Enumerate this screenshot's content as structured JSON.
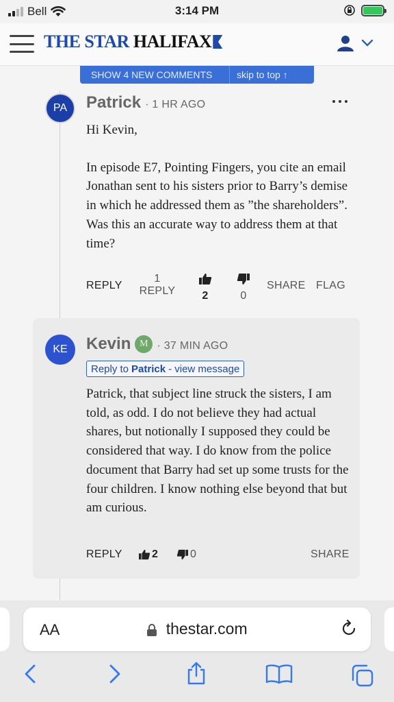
{
  "status_bar": {
    "carrier": "Bell",
    "time": "3:14 PM"
  },
  "header": {
    "logo_part1": "THE STAR",
    "logo_part2": "HALIFAX"
  },
  "banner": {
    "new_comments": "SHOW 4 NEW COMMENTS",
    "skip": "skip to top ↑"
  },
  "comments": [
    {
      "initials": "PA",
      "author": "Patrick",
      "time": "· 1 HR AGO",
      "paragraphs": [
        "Hi Kevin,",
        "In episode E7, Pointing Fingers, you cite an email Jonathan sent to his sisters prior to Barry’s demise in which he addressed them as ”the shareholders”. Was this an accurate way to address them at that time?"
      ],
      "reply_label": "REPLY",
      "reply_count": "1",
      "reply_count_label": "REPLY",
      "likes": "2",
      "dislikes": "0",
      "share": "SHARE",
      "flag": "FLAG"
    },
    {
      "initials": "KE",
      "author": "Kevin",
      "badge": "M",
      "time": "· 37 MIN AGO",
      "reply_to_prefix": "Reply to",
      "reply_to_name": "Patrick",
      "reply_to_suffix": "- view message",
      "paragraphs": [
        "Patrick, that subject line struck the sisters, I am told, as odd. I do not believe they had actual shares, but notionally I supposed they could be considered that way. I do know from the police document that Barry had set up some trusts for the four children. I know nothing else beyond that but am curious."
      ],
      "reply_label": "REPLY",
      "likes": "2",
      "dislikes": "0",
      "share": "SHARE"
    }
  ],
  "browser": {
    "aa": "AA",
    "url": "thestar.com"
  },
  "colors": {
    "brand": "#1f4aa8",
    "banner": "#3a6fd8",
    "badge": "#6ea86a"
  },
  "icons": [
    "signal-icon",
    "wifi-icon",
    "lock-rotation-icon",
    "battery-icon",
    "menu-icon",
    "user-icon",
    "chevron-down-icon",
    "thumbs-up-icon",
    "thumbs-down-icon",
    "more-icon",
    "padlock-icon",
    "reload-icon",
    "back-icon",
    "forward-icon",
    "share-icon",
    "bookmarks-icon",
    "tabs-icon"
  ]
}
